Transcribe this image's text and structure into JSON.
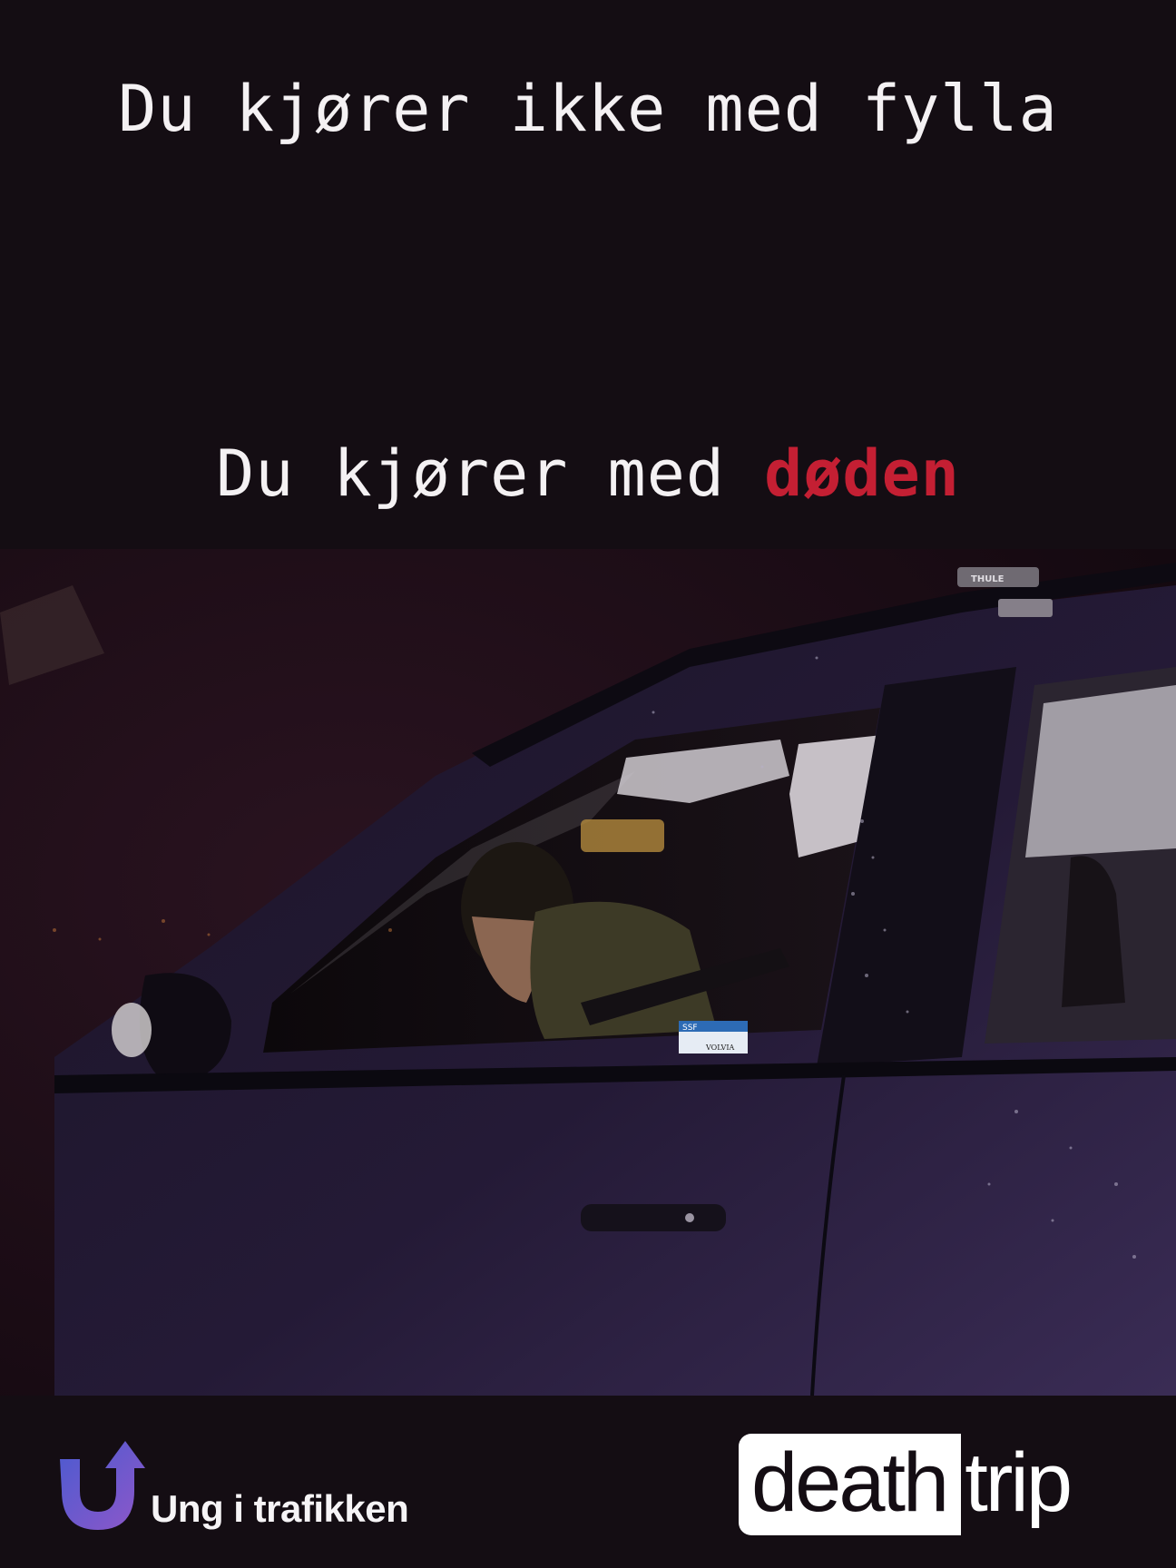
{
  "headline": {
    "line1": "Du kjører ikke med fylla",
    "line2_prefix": "Du kjører med ",
    "line2_accent": "døden"
  },
  "photo": {
    "sticker_top": "SSF",
    "sticker_bottom": "VOLVIA",
    "roof_brand": "THULE"
  },
  "footer": {
    "left_brand": "Ung i trafikken",
    "right_brand_part1": "death",
    "right_brand_part2": "trip"
  },
  "colors": {
    "background": "#140d13",
    "accent_red": "#c41f33",
    "text_white": "#f4f1f3",
    "logo_gradient_start": "#4b5bd0",
    "logo_gradient_end": "#8f57c9"
  }
}
